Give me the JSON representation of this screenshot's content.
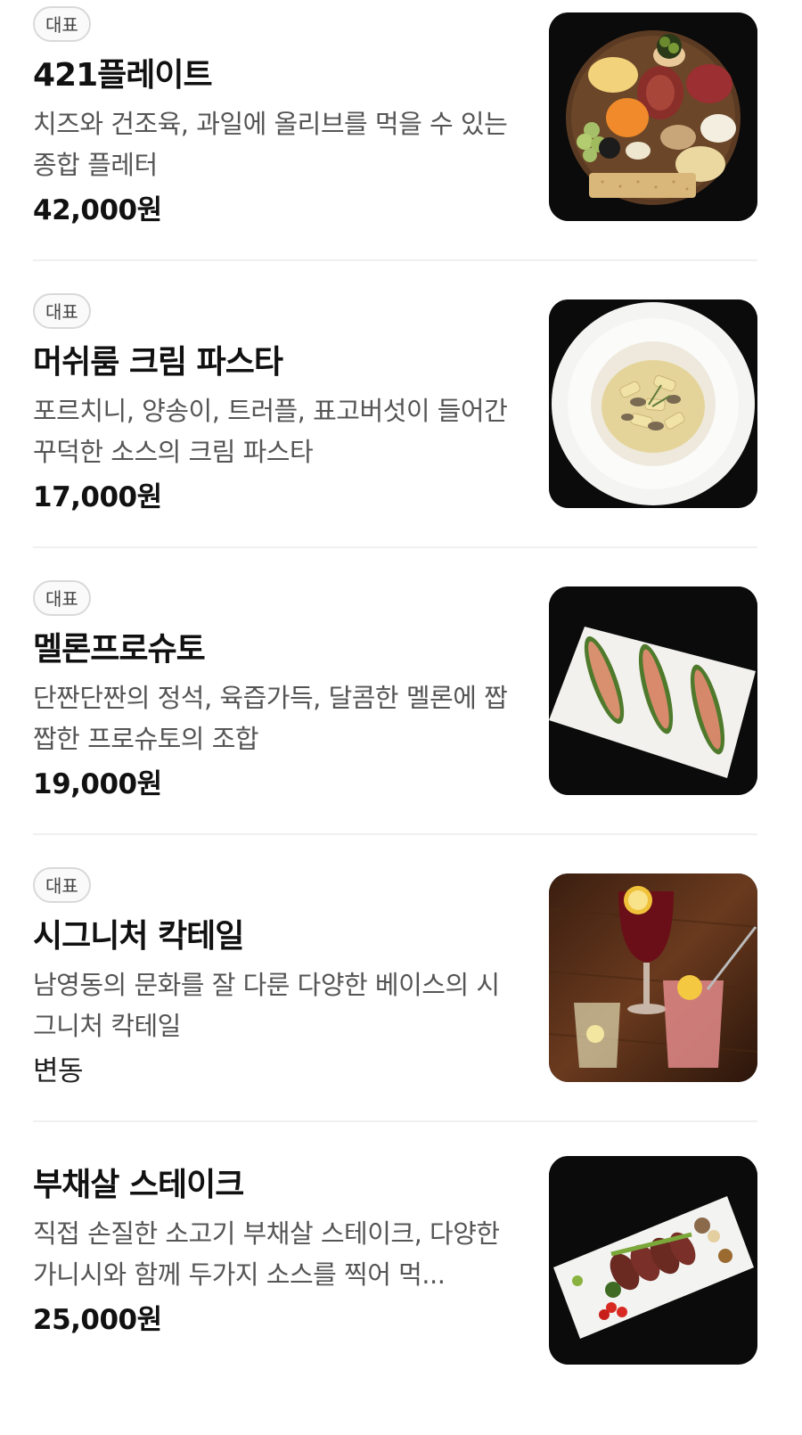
{
  "menu": {
    "items": [
      {
        "badge": "대표",
        "title": "421플레이트",
        "description": "치즈와 건조육, 과일에 올리브를 먹을 수 있는 종합 플레터",
        "price": "42,000원",
        "image": "charcuterie-board-photo"
      },
      {
        "badge": "대표",
        "title": "머쉬룸 크림 파스타",
        "description": "포르치니, 양송이, 트러플, 표고버섯이 들어간 꾸덕한 소스의 크림 파스타",
        "price": "17,000원",
        "image": "cream-pasta-photo"
      },
      {
        "badge": "대표",
        "title": "멜론프로슈토",
        "description": "단짠단짠의 정석, 육즙가득, 달콤한 멜론에 짭짭한 프로슈토의 조합",
        "price": "19,000원",
        "image": "melon-prosciutto-photo"
      },
      {
        "badge": "대표",
        "title": "시그니처 칵테일",
        "description": "남영동의 문화를 잘 다룬 다양한 베이스의 시그니처 칵테일",
        "price": "변동",
        "image": "signature-cocktails-photo"
      },
      {
        "title": "부채살 스테이크",
        "description": "직접 손질한 소고기 부채살 스테이크, 다양한 가니시와 함께 두가지 소스를 찍어 먹...",
        "price": "25,000원",
        "image": "steak-plate-photo"
      }
    ]
  }
}
